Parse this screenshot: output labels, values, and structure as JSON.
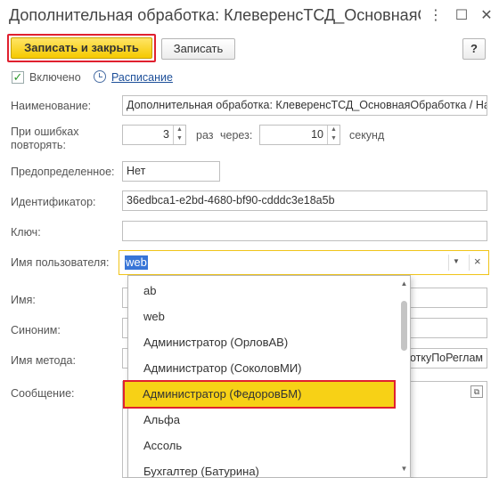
{
  "window": {
    "title": "Дополнительная обработка: КлеверенсТСД_ОсновнаяОбработка / Настройки",
    "more_icon": "⋮",
    "restore_icon": "☐",
    "close_icon": "✕"
  },
  "toolbar": {
    "save_close_label": "Записать и закрыть",
    "save_label": "Записать",
    "help_label": "?"
  },
  "enabled": {
    "label": "Включено",
    "checked": true
  },
  "schedule": {
    "label": "Расписание"
  },
  "form": {
    "name_label": "Наименование:",
    "name_value": "Дополнительная обработка: КлеверенсТСД_ОсновнаяОбработка / Настройки",
    "retry_label_1": "При ошибках",
    "retry_label_2": "повторять:",
    "retry_count": "3",
    "retry_times_label": "раз",
    "retry_every_label": "через:",
    "retry_seconds": "10",
    "retry_seconds_label": "секунд",
    "predefined_label": "Предопределенное:",
    "predefined_value": "Нет",
    "identifier_label": "Идентификатор:",
    "identifier_value": "36edbca1-e2bd-4680-bf90-cdddc3e18a5b",
    "key_label": "Ключ:",
    "key_value": "",
    "username_label": "Имя пользователя:",
    "username_value": "web",
    "name2_label": "Имя:",
    "synonym_label": "Синоним:",
    "method_label": "Имя метода:",
    "method_value": "откуПоРеглам",
    "message_label": "Сообщение:"
  },
  "user_dropdown": {
    "items": [
      {
        "label": "ab"
      },
      {
        "label": "web"
      },
      {
        "label": "Администратор (ОрловАВ)"
      },
      {
        "label": "Администратор (СоколовМИ)"
      },
      {
        "label": "Администратор (ФедоровБМ)",
        "highlighted": true
      },
      {
        "label": "Альфа"
      },
      {
        "label": "Ассоль"
      },
      {
        "label": "Бухгалтер (Батурина)"
      }
    ]
  },
  "colors": {
    "primary_button": "#f5c900",
    "highlight_border": "#e0202f",
    "selected_item": "#f7d116",
    "link": "#1d4f99",
    "checkbox_mark": "#2e9a2e"
  }
}
